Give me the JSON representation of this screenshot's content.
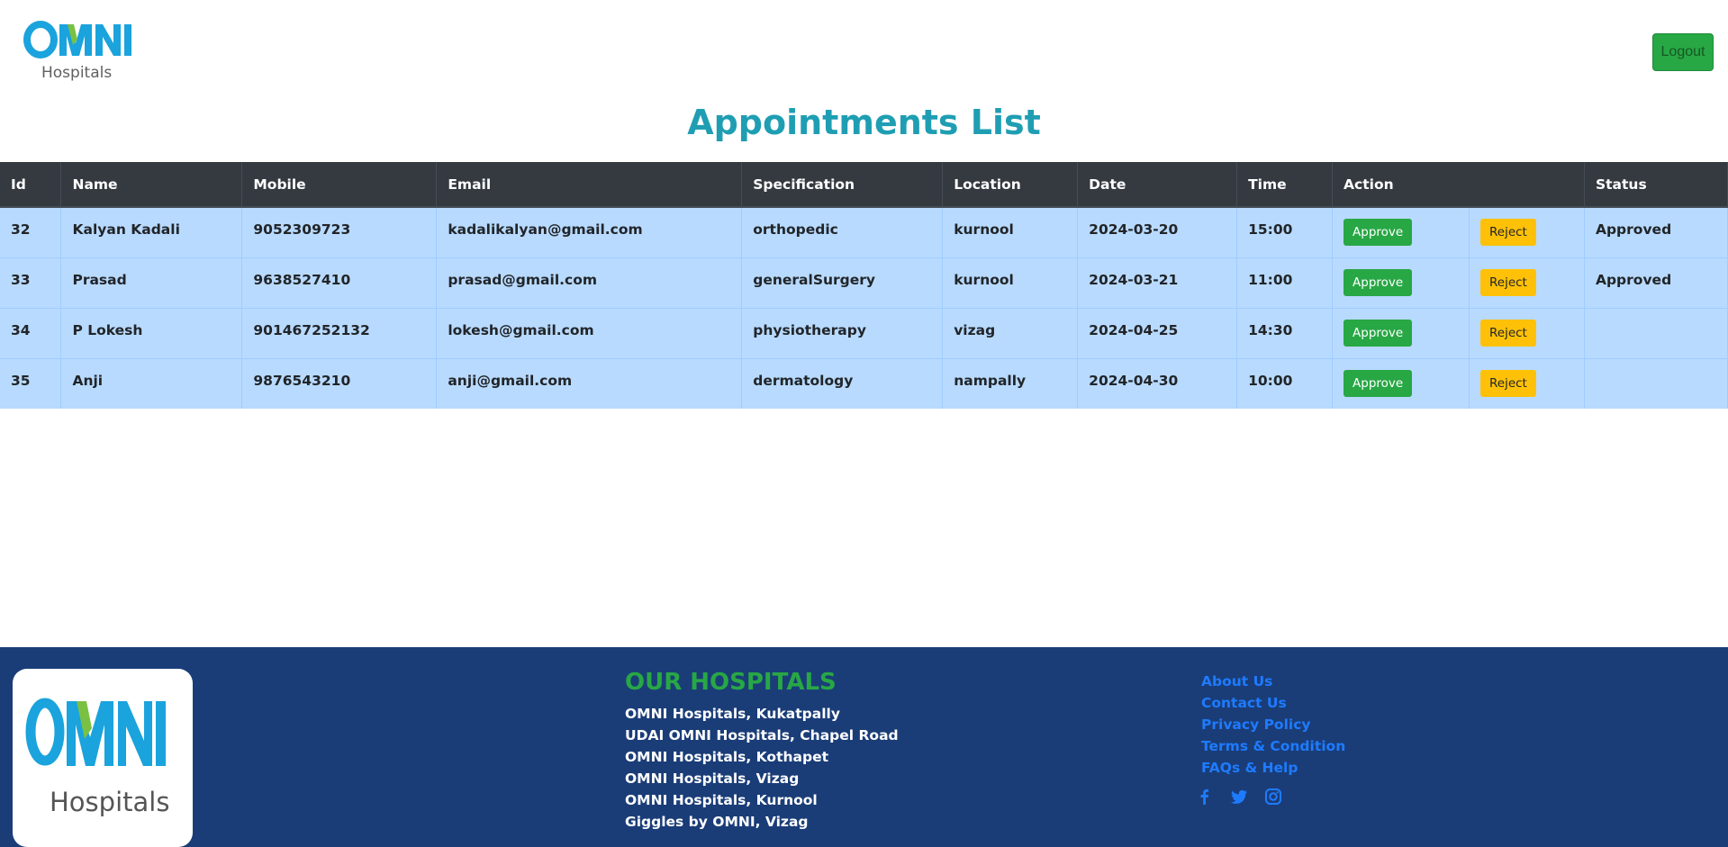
{
  "header": {
    "logo_main": "OMNI",
    "logo_sub": "Hospitals",
    "logout_label": "Logout"
  },
  "page_title": "Appointments List",
  "table": {
    "columns": [
      "Id",
      "Name",
      "Mobile",
      "Email",
      "Specification",
      "Location",
      "Date",
      "Time",
      "Action",
      "Status"
    ],
    "rows": [
      {
        "id": "32",
        "name": "Kalyan Kadali",
        "mobile": "9052309723",
        "email": "kadalikalyan@gmail.com",
        "specification": "orthopedic",
        "location": "kurnool",
        "date": "2024-03-20",
        "time": "15:00",
        "approve": "Approve",
        "reject": "Reject",
        "status": "Approved"
      },
      {
        "id": "33",
        "name": "Prasad",
        "mobile": "9638527410",
        "email": "prasad@gmail.com",
        "specification": "generalSurgery",
        "location": "kurnool",
        "date": "2024-03-21",
        "time": "11:00",
        "approve": "Approve",
        "reject": "Reject",
        "status": "Approved"
      },
      {
        "id": "34",
        "name": "P Lokesh",
        "mobile": "901467252132",
        "email": "lokesh@gmail.com",
        "specification": "physiotherapy",
        "location": "vizag",
        "date": "2024-04-25",
        "time": "14:30",
        "approve": "Approve",
        "reject": "Reject",
        "status": ""
      },
      {
        "id": "35",
        "name": "Anji",
        "mobile": "9876543210",
        "email": "anji@gmail.com",
        "specification": "dermatology",
        "location": "nampally",
        "date": "2024-04-30",
        "time": "10:00",
        "approve": "Approve",
        "reject": "Reject",
        "status": ""
      }
    ]
  },
  "footer": {
    "hospitals_title": "OUR HOSPITALS",
    "hospitals": [
      "OMNI Hospitals, Kukatpally",
      "UDAI OMNI Hospitals, Chapel Road",
      "OMNI Hospitals, Kothapet",
      "OMNI Hospitals, Vizag",
      "OMNI Hospitals, Kurnool",
      "Giggles by OMNI, Vizag"
    ],
    "links": [
      "About Us",
      "Contact Us",
      "Privacy Policy",
      "Terms & Condition",
      "FAQs & Help"
    ],
    "social_icons": [
      "facebook-icon",
      "twitter-icon",
      "instagram-icon"
    ]
  },
  "colors": {
    "brand_blue": "#1aa3dc",
    "brand_green": "#7ac143",
    "title_teal": "#1f9eb3",
    "footer_bg": "#1a3d78",
    "row_bg": "#b8daff",
    "header_bg": "#343a40"
  }
}
